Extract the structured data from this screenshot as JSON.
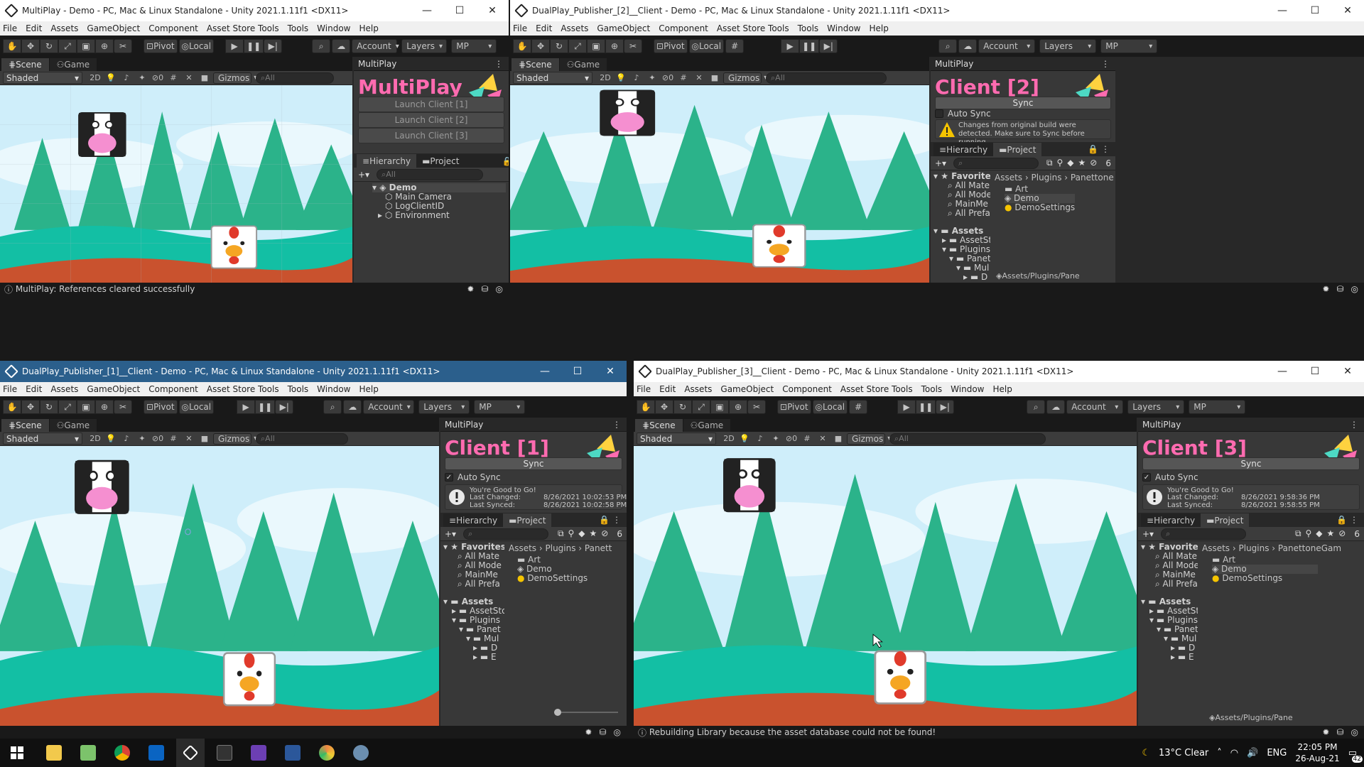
{
  "palette": {
    "sky": "#cfeefa",
    "tree": "#2bb38a",
    "grass": "#13bfa4",
    "dirt": "#c9522e",
    "pink": "#ff6bb0",
    "active_title": "#2b5f8c"
  },
  "toolbar": {
    "pivot": "Pivot",
    "local": "Local",
    "account": "Account",
    "layers": "Layers",
    "layout": "MP"
  },
  "menu": [
    "File",
    "Edit",
    "Assets",
    "GameObject",
    "Component",
    "Asset Store Tools",
    "Tools",
    "Window",
    "Help"
  ],
  "scene_view": {
    "tab_scene": "Scene",
    "tab_game": "Game",
    "shading": "Shaded",
    "two_d": "2D",
    "gizmos": "Gizmos",
    "search": "All",
    "hidden_count": "0"
  },
  "windows": {
    "main": {
      "title": "MultiPlay - Demo - PC, Mac & Linux Standalone - Unity 2021.1.11f1 <DX11>",
      "panel_tab": "MultiPlay",
      "panel_title": "MultiPlay",
      "launch": [
        "Launch Client [1]",
        "Launch Client [2]",
        "Launch Client [3]"
      ],
      "hierarchy_tab": "Hierarchy",
      "project_tab": "Project",
      "hierarchy_search": "All",
      "hierarchy": {
        "root": "Demo",
        "children": [
          "Main Camera",
          "LogClientID",
          "Environment"
        ]
      },
      "status": "MultiPlay: References cleared successfully"
    },
    "c2": {
      "title": "DualPlay_Publisher_[2]__Client - Demo - PC, Mac & Linux Standalone - Unity 2021.1.11f1 <DX11>",
      "panel_tab": "MultiPlay",
      "panel_title": "Client [2]",
      "sync": "Sync",
      "auto_sync": "Auto Sync",
      "auto_checked": false,
      "warning": "Changes from original build were detected. Make sure to Sync before running",
      "breadcrumb": [
        "Assets",
        "Plugins",
        "PanettoneGam"
      ],
      "path": "Assets/Plugins/Pane"
    },
    "c1": {
      "title": "DualPlay_Publisher_[1]__Client - Demo - PC, Mac & Linux Standalone - Unity 2021.1.11f1 <DX11>",
      "panel_tab": "MultiPlay",
      "panel_title": "Client [1]",
      "sync": "Sync",
      "auto_sync": "Auto Sync",
      "auto_checked": true,
      "info": {
        "msg": "You're Good to Go!",
        "changed_label": "Last Changed:",
        "changed": "8/26/2021 10:02:53 PM",
        "synced_label": "Last Synced:",
        "synced": "8/26/2021 10:02:58 PM"
      },
      "breadcrumb": [
        "Assets",
        "Plugins",
        "Panett"
      ]
    },
    "c3": {
      "title": "DualPlay_Publisher_[3]__Client - Demo - PC, Mac & Linux Standalone - Unity 2021.1.11f1 <DX11>",
      "panel_tab": "MultiPlay",
      "panel_title": "Client [3]",
      "sync": "Sync",
      "auto_sync": "Auto Sync",
      "auto_checked": true,
      "info": {
        "msg": "You're Good to Go!",
        "changed_label": "Last Changed:",
        "changed": "8/26/2021 9:58:36 PM",
        "synced_label": "Last Synced:",
        "synced": "8/26/2021 9:58:55 PM"
      },
      "breadcrumb": [
        "Assets",
        "Plugins",
        "PanettoneGam"
      ],
      "path": "Assets/Plugins/Pane",
      "status": "Rebuilding Library because the asset database could not be found!"
    }
  },
  "project": {
    "favorites": "Favorites",
    "fav_items": [
      "All Mater",
      "All Mode",
      "MainMe",
      "All Prefa"
    ],
    "fav_items_c1": [
      "All Mate",
      "All Mode",
      "MainMe",
      "All Prefa"
    ],
    "assets": "Assets",
    "asset_items": [
      "AssetSto",
      "Plugins",
      "Panet",
      "Mul",
      "D",
      "E"
    ],
    "files": [
      "Art",
      "Demo",
      "DemoSettings"
    ],
    "count": "6"
  },
  "taskbar": {
    "temp": "13°C",
    "weather": "Clear",
    "lang": "ENG",
    "time": "22:05 PM",
    "date": "26-Aug-21",
    "notif": "42"
  }
}
